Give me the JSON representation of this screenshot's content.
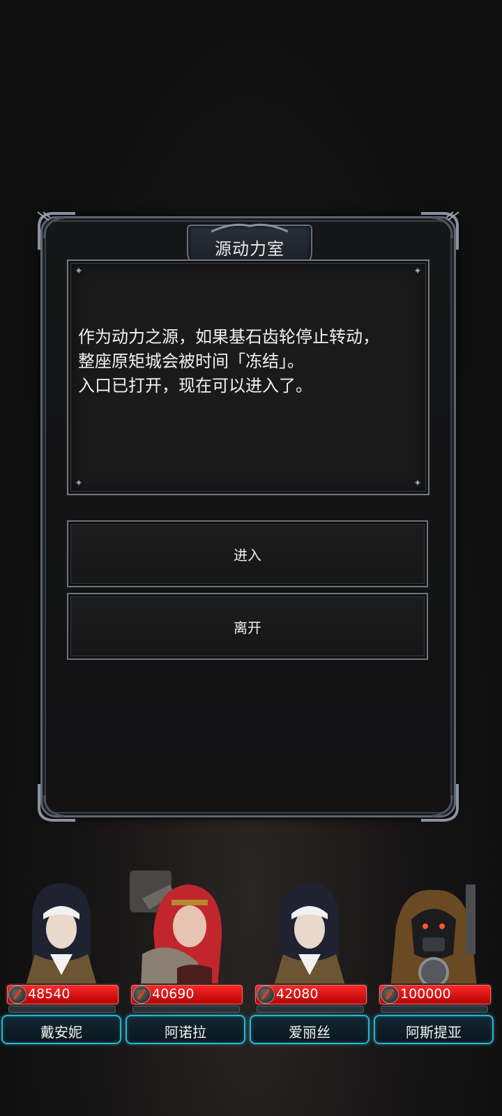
{
  "dialog": {
    "title": "源动力室",
    "message": "作为动力之源，如果基石齿轮停止转动，\n整座原矩城会被时间「冻结」。\n入口已打开，现在可以进入了。",
    "options": [
      {
        "label": "进入"
      },
      {
        "label": "离开"
      }
    ]
  },
  "party": [
    {
      "name": "戴安妮",
      "hp": "48540",
      "portrait": "nun"
    },
    {
      "name": "阿诺拉",
      "hp": "40690",
      "portrait": "red-haired-warrior"
    },
    {
      "name": "爱丽丝",
      "hp": "42080",
      "portrait": "nun"
    },
    {
      "name": "阿斯提亚",
      "hp": "100000",
      "portrait": "hooded-mechanic"
    }
  ],
  "colors": {
    "hp_bar": "#e01010",
    "name_plate_glow": "#2ab5d0",
    "frame": "#5f6670"
  }
}
